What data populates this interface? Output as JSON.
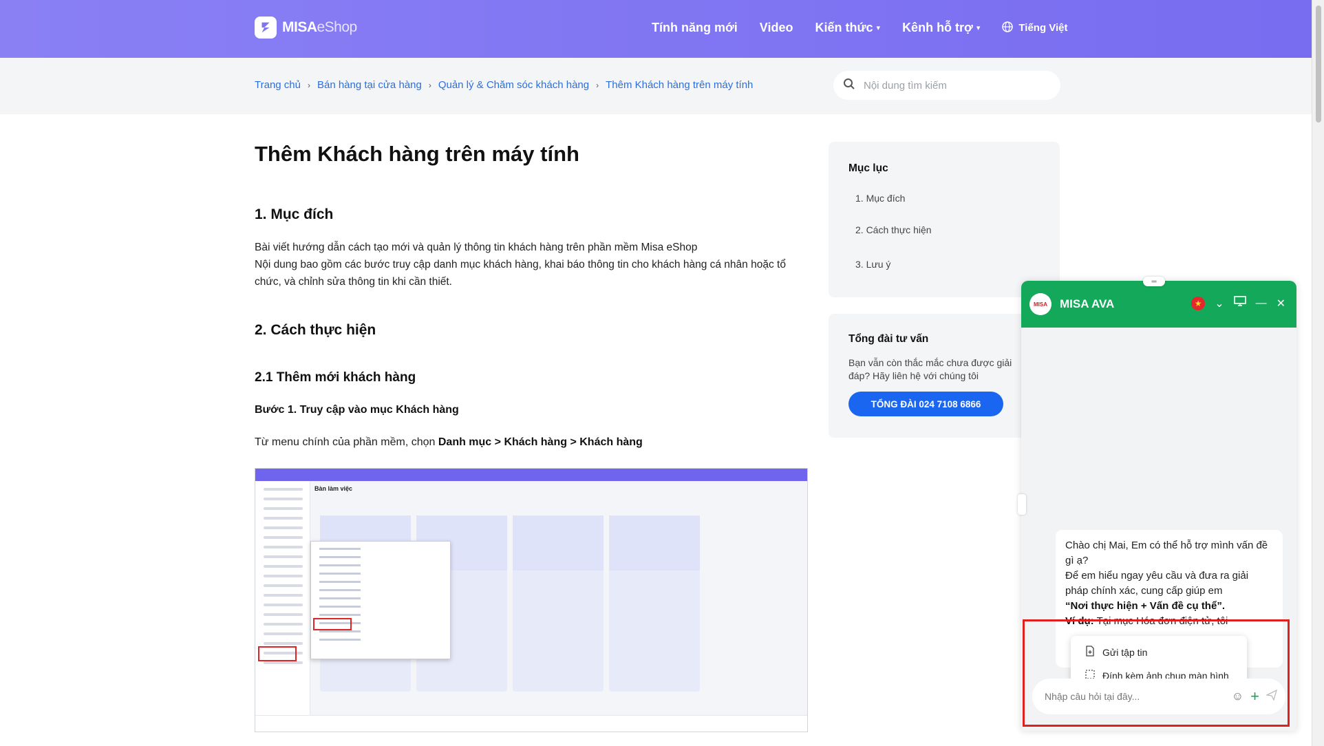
{
  "brand": {
    "name_bold": "MISA",
    "name_light": "eShop"
  },
  "nav": {
    "items": [
      {
        "label": "Tính năng mới"
      },
      {
        "label": "Video"
      },
      {
        "label": "Kiến thức"
      },
      {
        "label": "Kênh hỗ trợ"
      }
    ],
    "language": "Tiếng Việt"
  },
  "breadcrumb": [
    "Trang chủ",
    "Bán hàng tại cửa hàng",
    "Quản lý & Chăm sóc khách hàng",
    "Thêm Khách hàng trên máy tính"
  ],
  "search": {
    "placeholder": "Nội dung tìm kiếm"
  },
  "article": {
    "title": "Thêm Khách hàng trên máy tính",
    "h1": "1. Mục đích",
    "p1": "Bài viết hướng dẫn cách tạo mới và quản lý thông tin khách hàng trên phần mềm Misa eShop",
    "p2": "Nội dung bao gồm các bước truy cập danh mục khách hàng, khai báo thông tin cho khách hàng cá nhân hoặc tổ chức, và chỉnh sửa thông tin khi cần thiết.",
    "h2": "2. Cách thực hiện",
    "h3": "2.1 Thêm mới khách hàng",
    "step1": "Bước 1. Truy cập vào mục Khách hàng",
    "menu_intro": "Từ menu chính của phần mềm, chọn",
    "menu_path": "Danh mục > Khách hàng > Khách hàng",
    "screenshot_label": "Bàn làm việc"
  },
  "toc": {
    "title": "Mục lục",
    "items": [
      "1. Mục đích",
      "2. Cách thực hiện",
      "3. Lưu ý"
    ]
  },
  "advice": {
    "title": "Tổng đài tư vấn",
    "text": "Bạn vẫn còn thắc mắc chưa được giải đáp? Hãy liên hệ với chúng tôi",
    "button": "TỔNG ĐÀI 024 7108 6866"
  },
  "chat": {
    "title": "MISA AVA",
    "logo_text": "MISA",
    "greeting_1": "Chào chị Mai, Em có thể hỗ trợ mình vấn đề gì ạ?",
    "greeting_2": "Để em hiểu ngay yêu cầu và đưa ra giải pháp chính xác, cung cấp giúp em",
    "greeting_bold": "“Nơi thực hiện + Vấn đề cụ thể”.",
    "example_label": "Ví dụ:",
    "example_text": "Tại mục Hóa đơn điện tử, tôi",
    "attach_options": [
      "Gửi tập tin",
      "Đính kèm ảnh chụp màn hình"
    ],
    "input_placeholder": "Nhập câu hỏi tại đây..."
  },
  "colors": {
    "header": "#7f74f2",
    "link": "#2d6ed8",
    "chat_green": "#14a85a",
    "cta_blue": "#1a66f0",
    "highlight_red": "#e01f1f"
  }
}
